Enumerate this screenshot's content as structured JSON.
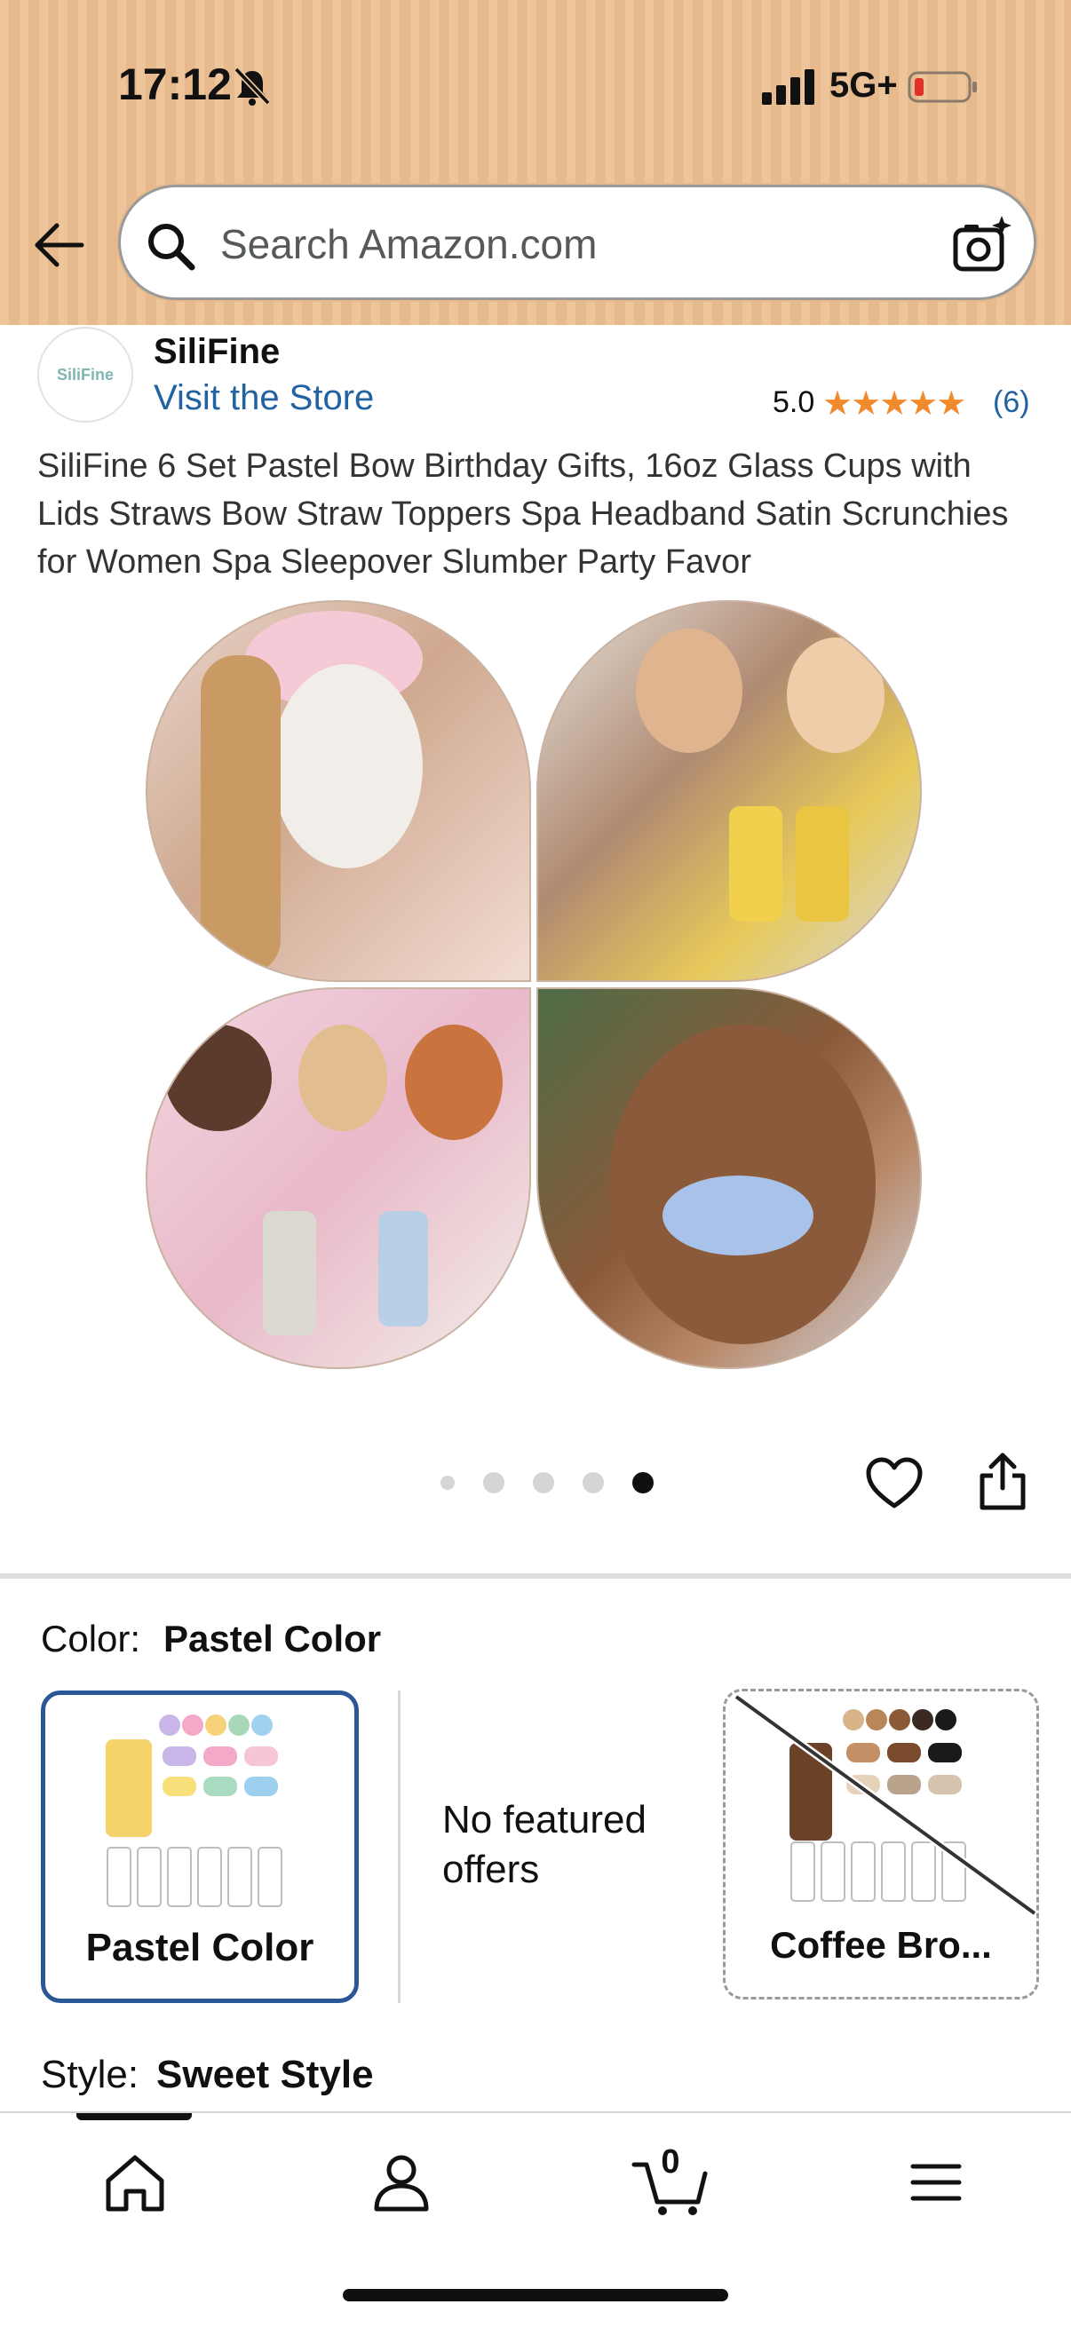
{
  "status_bar": {
    "time": "17:12",
    "network": "5G+"
  },
  "search": {
    "placeholder": "Search Amazon.com"
  },
  "brand": {
    "logo_text": "SiliFine",
    "name": "SiliFine",
    "visit_store": "Visit the Store"
  },
  "rating": {
    "value": "5.0",
    "stars": 5,
    "stars_text": "★★★★★",
    "count": "(6)"
  },
  "product": {
    "title": "SiliFine 6 Set Pastel Bow Birthday Gifts, 16oz Glass Cups with Lids Straws Bow Straw Toppers Spa Headband Satin Scrunchies for Women Spa Sleepover Slumber Party Favor"
  },
  "gallery": {
    "image_count": 5,
    "active_index": 5
  },
  "variations": {
    "color_label": "Color:",
    "color_value": "Pastel Color",
    "options": [
      {
        "label": "Pastel Color",
        "selected": true
      },
      {
        "label": "No featured offers"
      },
      {
        "label": "Coffee Bro...",
        "available": false
      }
    ],
    "style_label": "Style:",
    "style_value": "Sweet Style"
  },
  "bottom_nav": {
    "cart_count": "0",
    "items": [
      "home-icon",
      "account-icon",
      "cart-icon",
      "menu-icon"
    ]
  },
  "colors": {
    "link": "#2162a1",
    "star": "#f08a2c",
    "selected_border": "#2b5797",
    "header_bg": "#eec49a"
  }
}
